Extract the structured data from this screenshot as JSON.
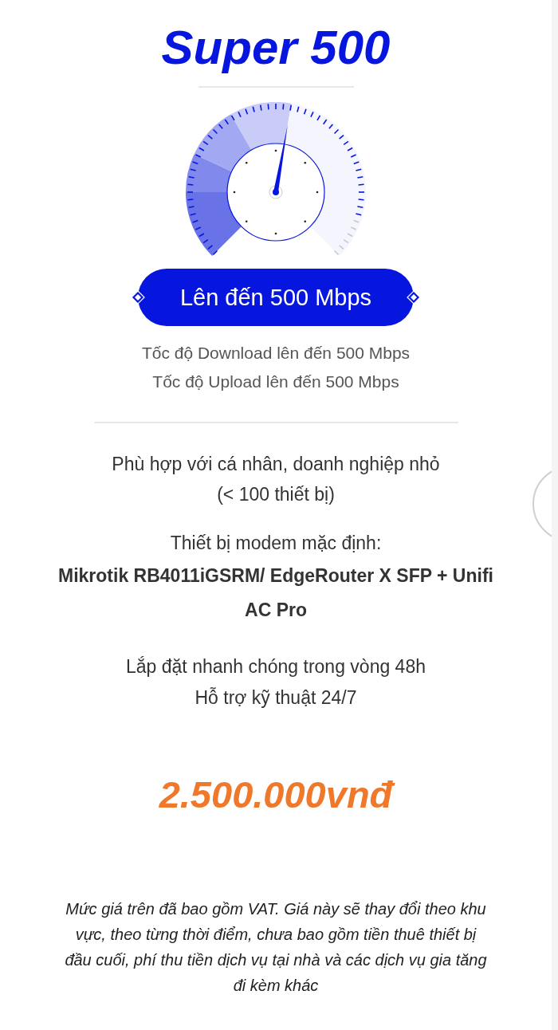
{
  "plan": {
    "title": "Super 500",
    "speed_badge": "Lên đến 500 Mbps",
    "speeds": [
      "Tốc độ Download lên đến 500 Mbps",
      "Tốc độ Upload lên đến 500 Mbps"
    ],
    "suitability": [
      "Phù hợp với cá nhân, doanh nghiệp nhỏ",
      "(< 100 thiết bị)"
    ],
    "modem": {
      "label": "Thiết bị modem mặc định:",
      "models": "Mikrotik RB4011iGSRM/ EdgeRouter X SFP + Unifi AC Pro"
    },
    "service": [
      "Lắp đặt nhanh chóng trong vòng 48h",
      "Hỗ trợ kỹ thuật 24/7"
    ],
    "price": "2.500.000vnđ",
    "note": "Mức giá trên đã bao gồm VAT. Giá này sẽ thay đổi theo khu vực, theo từng thời điểm, chưa bao gồm tiền thuê thiết bị đầu cuối, phí thu tiền dịch vụ tại nhà và các dịch vụ gia tăng đi kèm khác"
  }
}
